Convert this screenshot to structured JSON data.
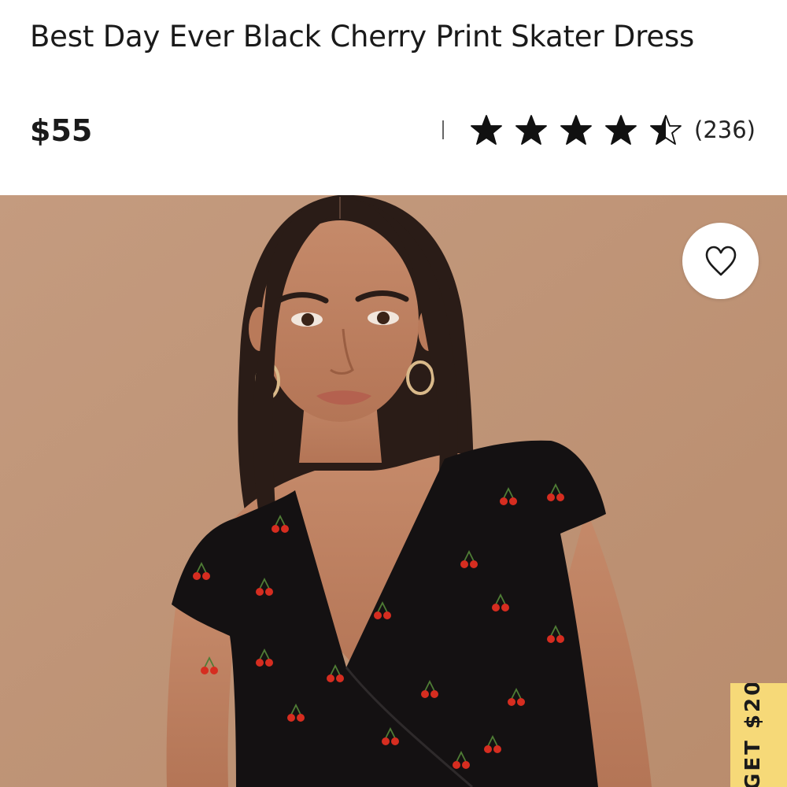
{
  "product": {
    "title": "Best Day Ever Black Cherry Print Skater Dress",
    "price": "$55",
    "rating": {
      "value": 4.5,
      "max": 5,
      "review_count": "(236)"
    }
  },
  "gallery": {
    "wishlist_icon": "heart-icon",
    "photo_subject": "model-in-black-cherry-print-dress"
  },
  "promo_tab": {
    "label": "GET $20!"
  },
  "colors": {
    "background": "#ffffff",
    "text": "#1a1a1a",
    "photo_backdrop": "#c3977a",
    "promo_tab": "#f6d978",
    "cherry": "#d62d20"
  }
}
